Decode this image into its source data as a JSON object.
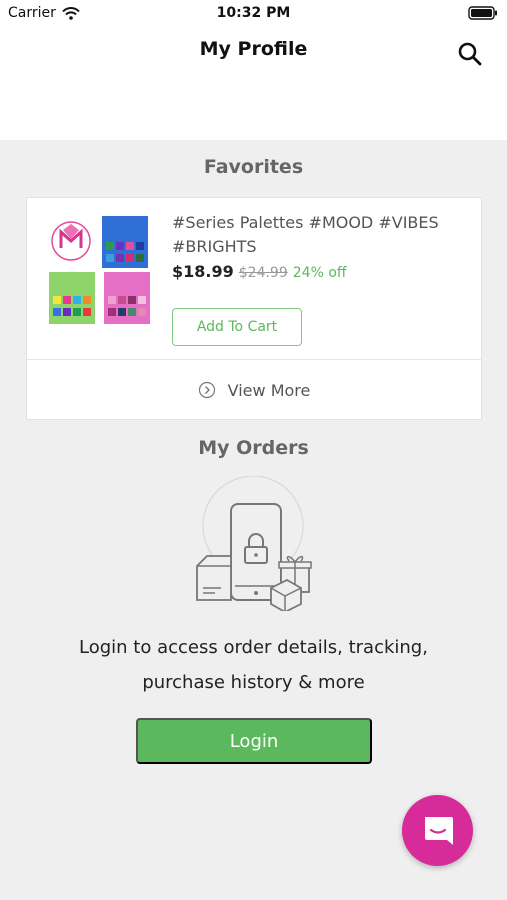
{
  "status_bar": {
    "carrier": "Carrier",
    "time": "10:32 PM"
  },
  "header": {
    "title": "My Profile"
  },
  "favorites": {
    "heading": "Favorites",
    "product": {
      "name": "#Series Palettes #MOOD #VIBES #BRIGHTS",
      "price": "$18.99",
      "original_price": "$24.99",
      "discount": "24% off",
      "add_to_cart_label": "Add To Cart"
    },
    "view_more_label": "View More"
  },
  "orders": {
    "heading": "My Orders",
    "message_line1": "Login to access order details, tracking,",
    "message_line2": "purchase history & more",
    "login_label": "Login"
  },
  "icons": {
    "search": "search-icon",
    "view_more": "chevron-right-circle-icon",
    "chat": "chat-icon",
    "wifi": "wifi-icon",
    "battery": "battery-icon"
  },
  "colors": {
    "accent_green": "#5cb85c",
    "chat_pink": "#d62b98",
    "background": "#efefef"
  }
}
